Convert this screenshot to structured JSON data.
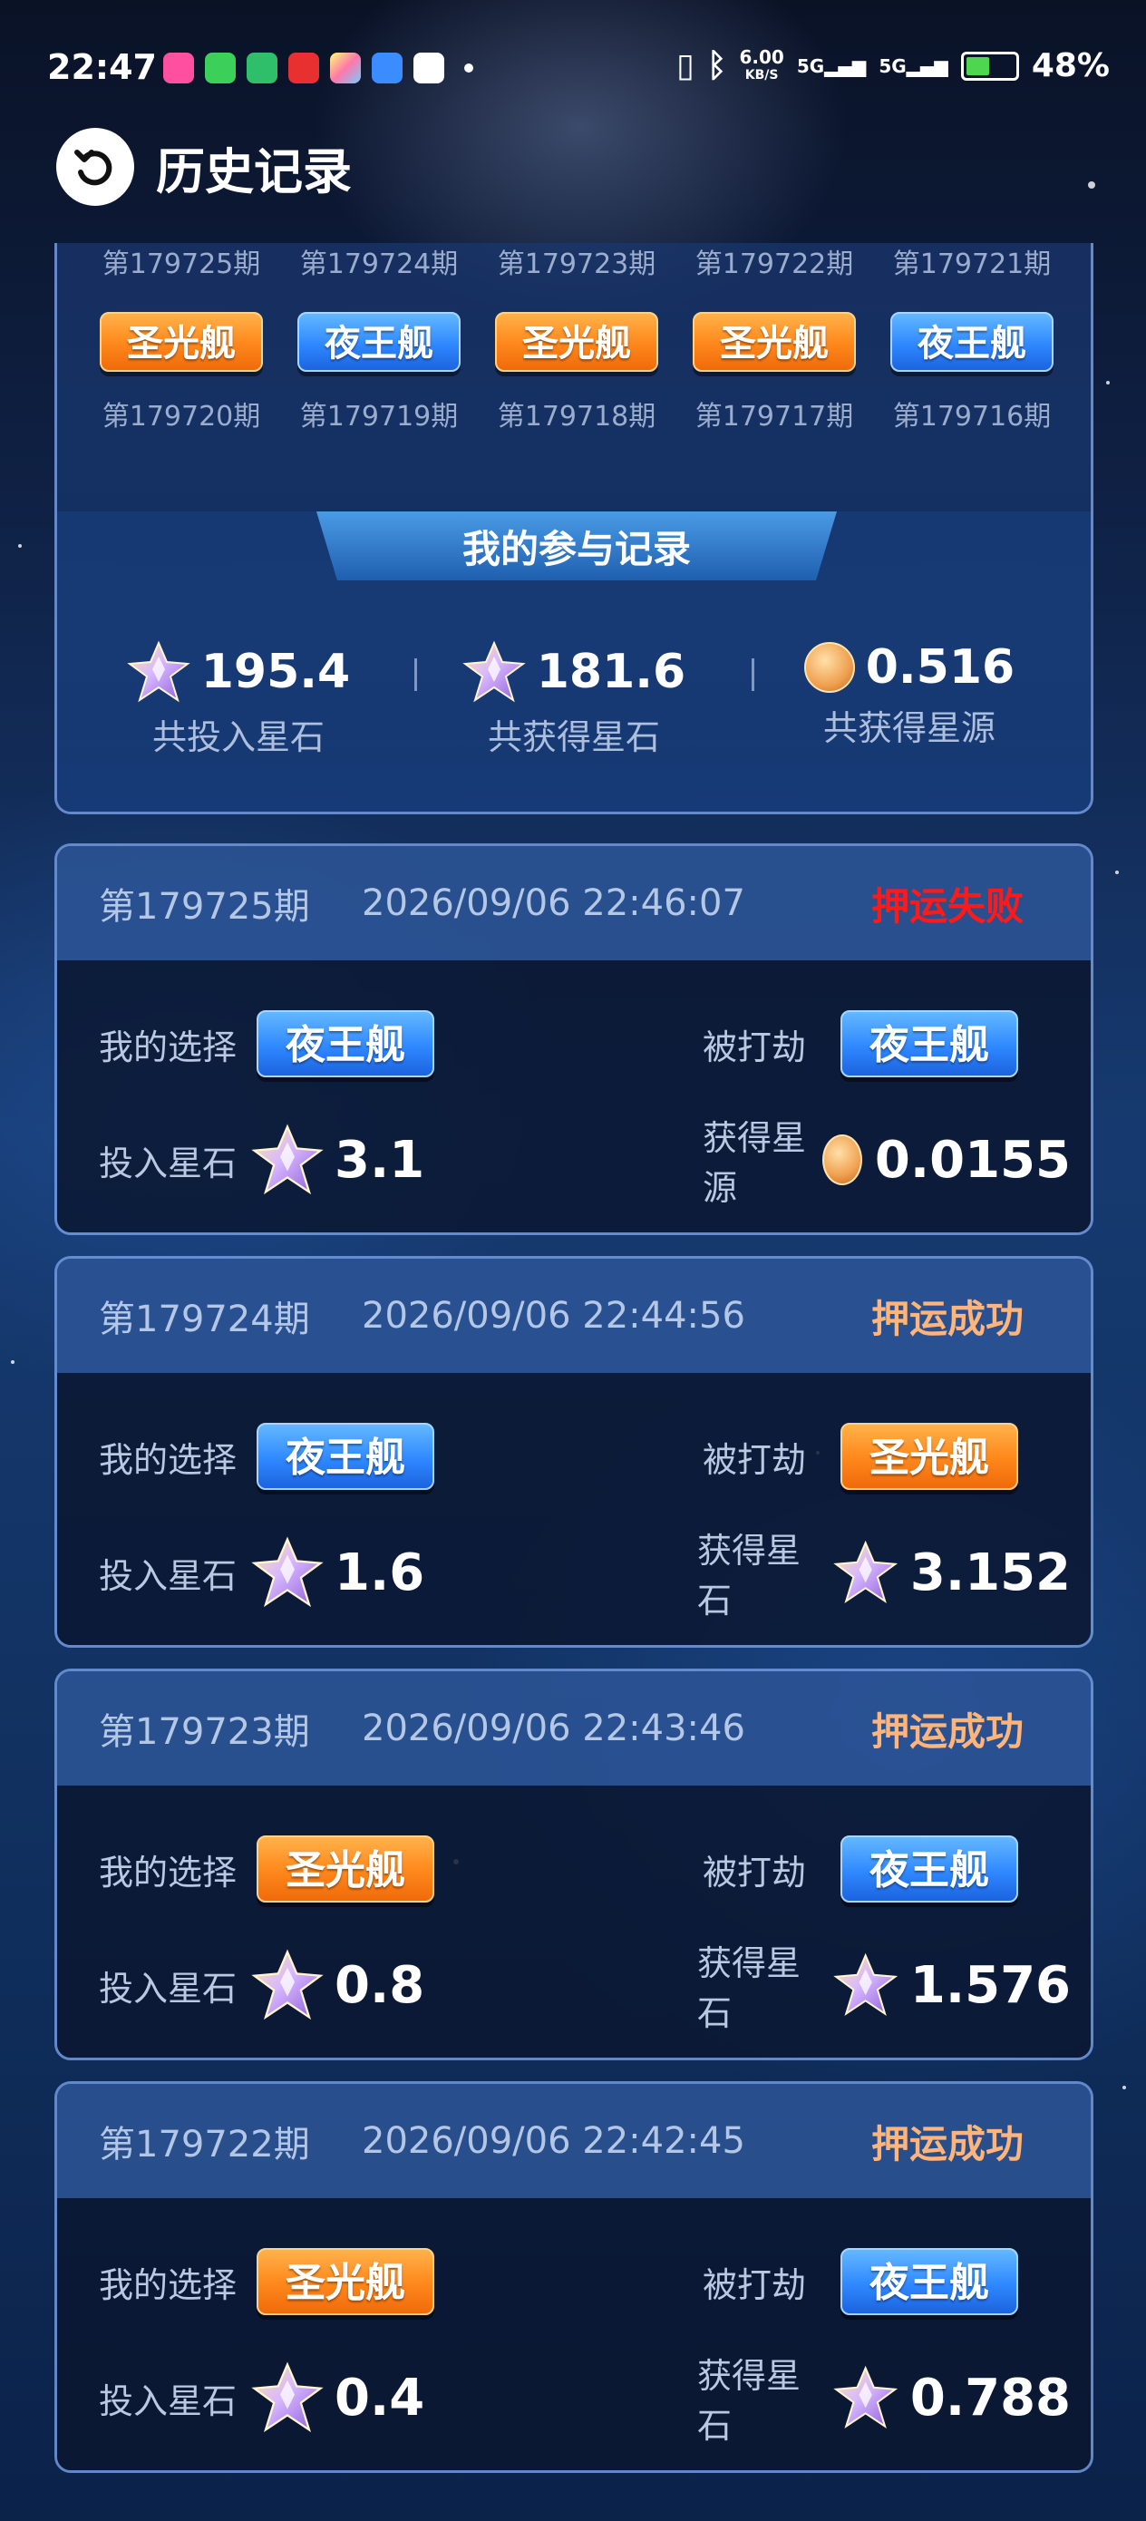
{
  "status_bar": {
    "time": "22:47",
    "network_speed_value": "6.00",
    "network_speed_unit": "KB/S",
    "signal1_label": "5G",
    "signal2_label": "5G",
    "battery_percent": "48%",
    "battery_level": 0.48
  },
  "header": {
    "title": "历史记录"
  },
  "history_grid": {
    "top_partial_periods": [
      "第179725期",
      "第179724期",
      "第179723期",
      "第179722期",
      "第179721期"
    ],
    "ships": [
      {
        "label": "圣光舰",
        "color": "orange"
      },
      {
        "label": "夜王舰",
        "color": "blue"
      },
      {
        "label": "圣光舰",
        "color": "orange"
      },
      {
        "label": "圣光舰",
        "color": "orange"
      },
      {
        "label": "夜王舰",
        "color": "blue"
      }
    ],
    "periods": [
      "第179720期",
      "第179719期",
      "第179718期",
      "第179717期",
      "第179716期"
    ]
  },
  "participation": {
    "title": "我的参与记录",
    "total_invested": {
      "value": "195.4",
      "label": "共投入星石"
    },
    "total_gained_stones": {
      "value": "181.6",
      "label": "共获得星石"
    },
    "total_gained_source": {
      "value": "0.516",
      "label": "共获得星源"
    }
  },
  "labels": {
    "my_choice": "我的选择",
    "robbed": "被打劫",
    "invested_stone": "投入星石",
    "gained_stone": "获得星石",
    "gained_source": "获得星源"
  },
  "records": [
    {
      "period": "第179725期",
      "time": "2026/09/06 22:46:07",
      "result": "押运失败",
      "result_type": "fail",
      "my_choice": "夜王舰",
      "my_choice_color": "blue",
      "robbed": "夜王舰",
      "robbed_color": "blue",
      "invested": "3.1",
      "gain_label": "获得星源",
      "gain_icon": "coin-icon",
      "gain_value": "0.0155"
    },
    {
      "period": "第179724期",
      "time": "2026/09/06 22:44:56",
      "result": "押运成功",
      "result_type": "success",
      "my_choice": "夜王舰",
      "my_choice_color": "blue",
      "robbed": "圣光舰",
      "robbed_color": "orange",
      "invested": "1.6",
      "gain_label": "获得星石",
      "gain_icon": "gem-icon",
      "gain_value": "3.152"
    },
    {
      "period": "第179723期",
      "time": "2026/09/06 22:43:46",
      "result": "押运成功",
      "result_type": "success",
      "my_choice": "圣光舰",
      "my_choice_color": "orange",
      "robbed": "夜王舰",
      "robbed_color": "blue",
      "invested": "0.8",
      "gain_label": "获得星石",
      "gain_icon": "gem-icon",
      "gain_value": "1.576"
    },
    {
      "period": "第179722期",
      "time": "2026/09/06 22:42:45",
      "result": "押运成功",
      "result_type": "success",
      "my_choice": "圣光舰",
      "my_choice_color": "orange",
      "robbed": "夜王舰",
      "robbed_color": "blue",
      "invested": "0.4",
      "gain_label": "获得星石",
      "gain_icon": "gem-icon",
      "gain_value": "0.788"
    }
  ]
}
